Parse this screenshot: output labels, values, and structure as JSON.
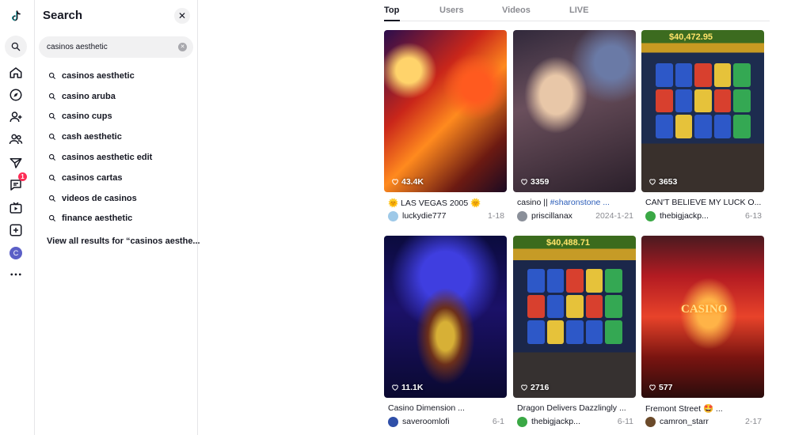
{
  "rail": {
    "items": [
      {
        "icon": "tiktok-logo-icon"
      },
      {
        "icon": "search-icon"
      },
      {
        "icon": "home-icon"
      },
      {
        "icon": "explore-icon"
      },
      {
        "icon": "following-icon"
      },
      {
        "icon": "friends-icon"
      },
      {
        "icon": "send-icon"
      },
      {
        "icon": "inbox-icon",
        "badge": "1"
      },
      {
        "icon": "live-icon"
      },
      {
        "icon": "upload-icon"
      },
      {
        "icon": "profile-avatar",
        "label": "C"
      },
      {
        "icon": "more-icon"
      }
    ]
  },
  "search_panel": {
    "title": "Search",
    "query": "casinos aesthetic",
    "suggestions": [
      "casinos aesthetic",
      "casino aruba",
      "casino cups",
      "cash aesthetic",
      "casinos aesthetic edit",
      "casinos cartas",
      "videos de casinos",
      "finance aesthetic"
    ],
    "view_all": "View all results for “casinos aesthe..."
  },
  "tabs": [
    {
      "label": "Top",
      "active": true
    },
    {
      "label": "Users",
      "active": false
    },
    {
      "label": "Videos",
      "active": false
    },
    {
      "label": "LIVE",
      "active": false
    }
  ],
  "videos": [
    {
      "likes": "43.4K",
      "caption_prefix": "🌞 LAS VEGAS 2005 🌞",
      "caption_tag": "",
      "user": "luckydie777",
      "date": "1-18",
      "avatar_color": "#9ec9e8",
      "thumb_color": "#c9261a"
    },
    {
      "likes": "3359",
      "caption_prefix": "casino || ",
      "caption_tag": "#sharonstone ...",
      "user": "priscillanax",
      "date": "2024-1-21",
      "avatar_color": "#8a8f99",
      "thumb_color": "#6a4f5c"
    },
    {
      "likes": "3653",
      "caption_prefix": "CAN'T BELIEVE MY LUCK O...",
      "caption_tag": "",
      "user": "thebigjackp...",
      "date": "6-13",
      "avatar_color": "#3aa845",
      "thumb_color": "#1d2c4f"
    },
    {
      "likes": "11.1K",
      "caption_prefix": "Casino Dimension ...",
      "caption_tag": "",
      "user": "saveroomlofi",
      "date": "6-1",
      "avatar_color": "#2f4fa8",
      "thumb_color": "#1b1168"
    },
    {
      "likes": "2716",
      "caption_prefix": "Dragon Delivers Dazzlingly ...",
      "caption_tag": "",
      "user": "thebigjackp...",
      "date": "6-11",
      "avatar_color": "#3aa845",
      "thumb_color": "#1b274a"
    },
    {
      "likes": "577",
      "caption_prefix": "Fremont Street 🤩 ...",
      "caption_tag": "",
      "user": "camron_starr",
      "date": "2-17",
      "avatar_color": "#6b4a2a",
      "thumb_color": "#b31b22"
    }
  ],
  "thumb_text": {
    "card3_sign": "$40,472.95",
    "card5_sign": "$40,488.71",
    "card6_sign": "CASINO"
  },
  "colors": {
    "accent": "#fe2c55",
    "link": "#2b5db9",
    "text": "#161823",
    "muted": "#8a8b91"
  }
}
